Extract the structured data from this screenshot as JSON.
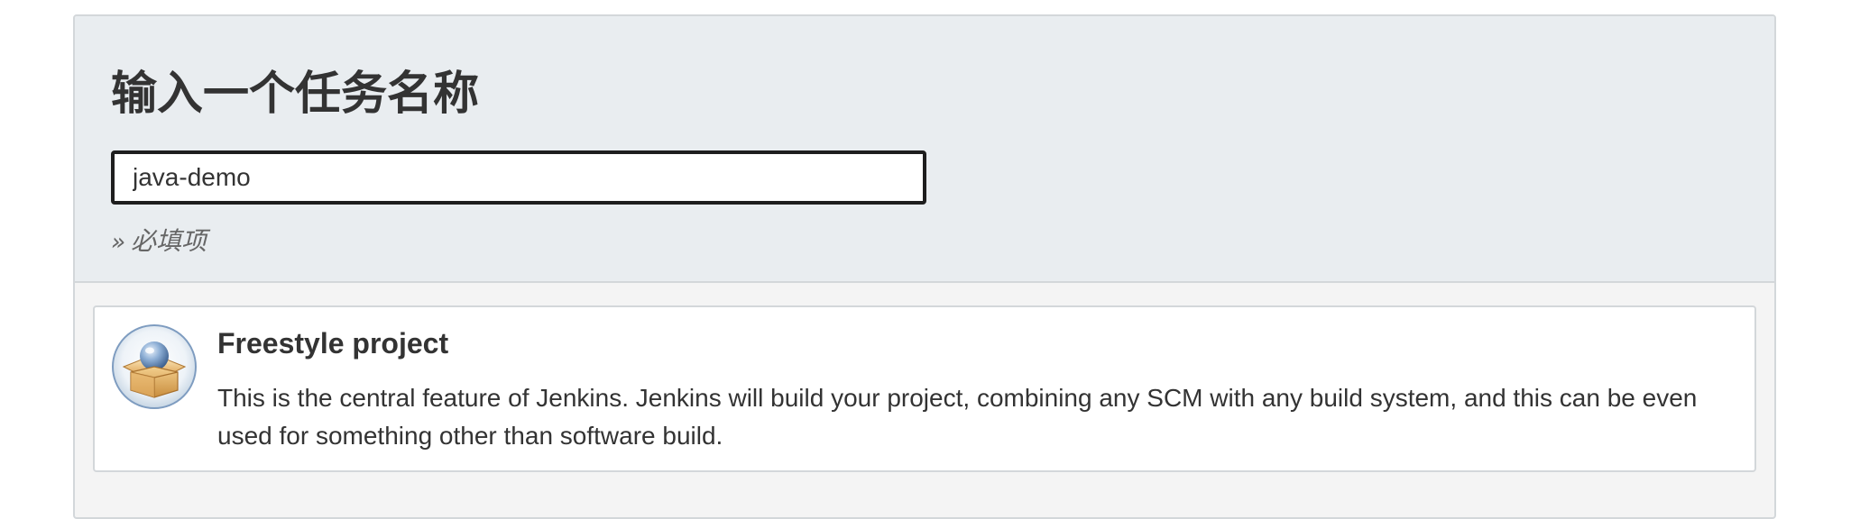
{
  "header": {
    "title": "输入一个任务名称"
  },
  "name_field": {
    "value": "java-demo",
    "placeholder": ""
  },
  "required_hint": {
    "arrows": "»",
    "text": "必填项"
  },
  "items": [
    {
      "title": "Freestyle project",
      "description": "This is the central feature of Jenkins. Jenkins will build your project, combining any SCM with any build system, and this can be even used for something other than software build.",
      "icon": "freestyle-project-icon"
    }
  ]
}
